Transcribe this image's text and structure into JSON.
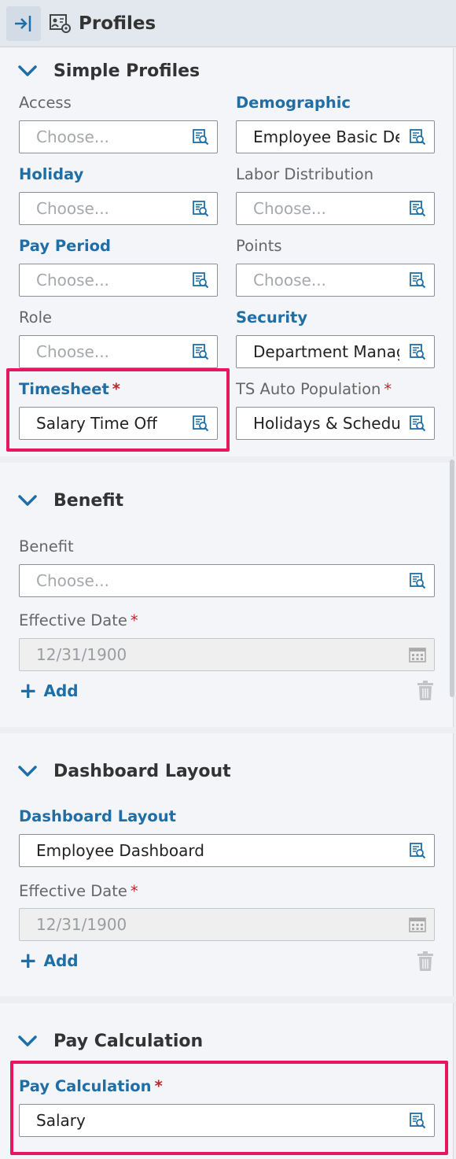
{
  "header": {
    "title": "Profiles"
  },
  "placeholder": "Choose...",
  "simple_profiles": {
    "title": "Simple Profiles",
    "fields": [
      {
        "label": "Access",
        "value": ""
      },
      {
        "label": "Demographic",
        "value": "Employee Basic Demographic"
      },
      {
        "label": "Holiday",
        "value": ""
      },
      {
        "label": "Labor Distribution",
        "value": ""
      },
      {
        "label": "Pay Period",
        "value": ""
      },
      {
        "label": "Points",
        "value": ""
      },
      {
        "label": "Role",
        "value": ""
      },
      {
        "label": "Security",
        "value": "Department Manager"
      },
      {
        "label": "Timesheet",
        "value": "Salary Time Off"
      },
      {
        "label": "TS Auto Population",
        "value": "Holidays & Schedules"
      }
    ]
  },
  "benefit": {
    "title": "Benefit",
    "benefit_label": "Benefit",
    "benefit_value": "",
    "date_label": "Effective Date",
    "date_value": "12/31/1900",
    "add_label": "Add"
  },
  "dashboard_layout": {
    "title": "Dashboard Layout",
    "layout_label": "Dashboard Layout",
    "layout_value": "Employee Dashboard",
    "date_label": "Effective Date",
    "date_value": "12/31/1900",
    "add_label": "Add"
  },
  "pay_calculation": {
    "title": "Pay Calculation",
    "label": "Pay Calculation",
    "value": "Salary"
  },
  "required_mark": "*",
  "add_symbol": "+",
  "colors": {
    "link": "#1f6fa6",
    "required": "#c0262d",
    "highlight": "#e8175d"
  }
}
